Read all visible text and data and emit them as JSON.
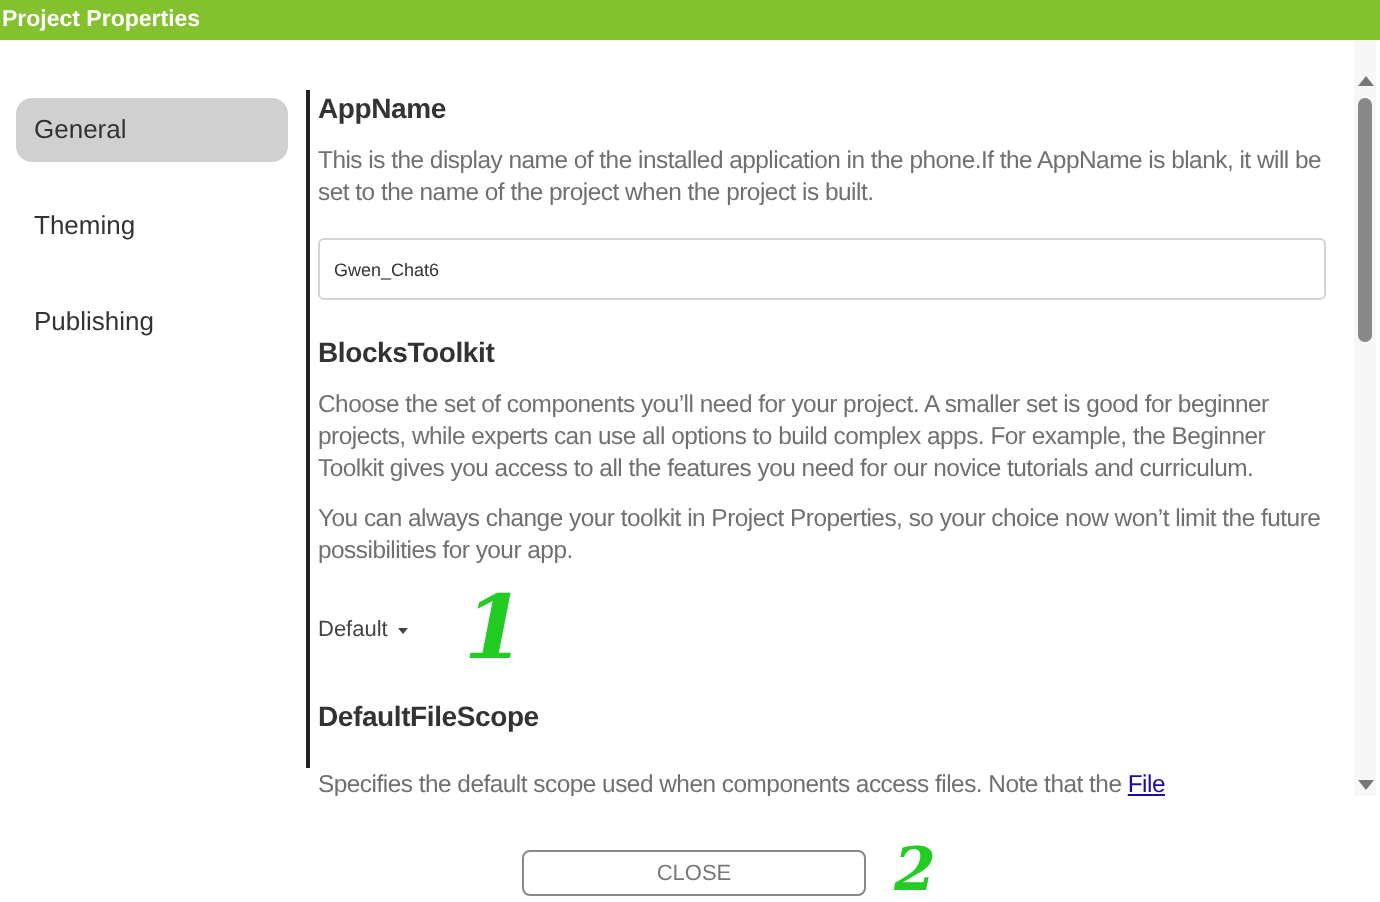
{
  "window": {
    "title": "Project Properties"
  },
  "sidebar": {
    "items": [
      {
        "label": "General",
        "selected": true
      },
      {
        "label": "Theming",
        "selected": false
      },
      {
        "label": "Publishing",
        "selected": false
      }
    ]
  },
  "sections": [
    {
      "heading": "AppName",
      "paragraphs": [
        "This is the display name of the installed application in the phone.If the AppName is blank, it will be set to the name of the project when the project is built."
      ],
      "kind": "text",
      "value": "Gwen_Chat6"
    },
    {
      "heading": "BlocksToolkit",
      "paragraphs": [
        "Choose the set of components you’ll need for your project. A smaller set is good for beginner projects, while experts can use all options to build complex apps. For example, the Beginner Toolkit gives you access to all the features you need for our novice tutorials and curriculum.",
        "You can always change your toolkit in Project Properties, so your choice now won’t limit the future possibilities for your app."
      ],
      "kind": "dropdown",
      "value": "Default"
    },
    {
      "heading": "DefaultFileScope",
      "paragraphs": [
        "Specifies the default scope used when components access files. Note that the"
      ],
      "link": "File",
      "kind": "none"
    }
  ],
  "buttons": [
    {
      "label": "CLOSE"
    }
  ],
  "annotations": [
    {
      "text": "1"
    },
    {
      "text": "2"
    }
  ]
}
